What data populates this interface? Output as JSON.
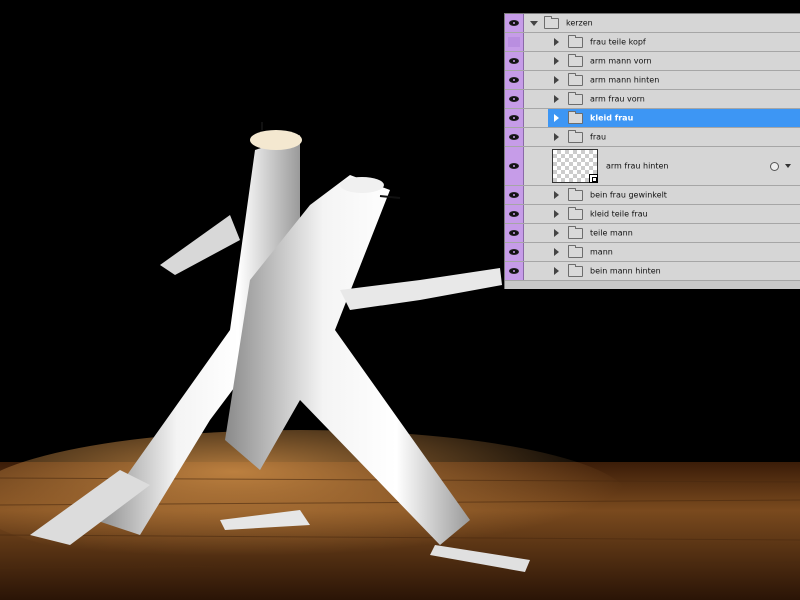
{
  "layers_panel": {
    "layers": [
      {
        "name": "kerzen",
        "type": "group",
        "visible": true,
        "expanded": true,
        "level": 0
      },
      {
        "name": "frau teile kopf",
        "type": "group",
        "visible": false,
        "level": 1
      },
      {
        "name": "arm mann vorn",
        "type": "group",
        "visible": true,
        "level": 1
      },
      {
        "name": "arm mann hinten",
        "type": "group",
        "visible": true,
        "level": 1
      },
      {
        "name": "arm frau vorn",
        "type": "group",
        "visible": true,
        "level": 1
      },
      {
        "name": "kleid frau",
        "type": "group",
        "visible": true,
        "level": 1,
        "selected": true
      },
      {
        "name": "frau",
        "type": "group",
        "visible": true,
        "level": 1
      },
      {
        "name": "arm frau hinten",
        "type": "smart-object",
        "visible": true,
        "level": 1
      },
      {
        "name": "bein frau gewinkelt",
        "type": "group",
        "visible": true,
        "level": 1
      },
      {
        "name": "kleid teile frau",
        "type": "group",
        "visible": true,
        "level": 1
      },
      {
        "name": "teile mann",
        "type": "group",
        "visible": true,
        "level": 1
      },
      {
        "name": "mann",
        "type": "group",
        "visible": true,
        "level": 1
      },
      {
        "name": "bein mann hinten",
        "type": "group",
        "visible": true,
        "level": 1
      }
    ]
  },
  "colors": {
    "selection": "#3d96f4",
    "eye_column": "#c69ce8",
    "panel_bg": "#d6d6d6"
  }
}
